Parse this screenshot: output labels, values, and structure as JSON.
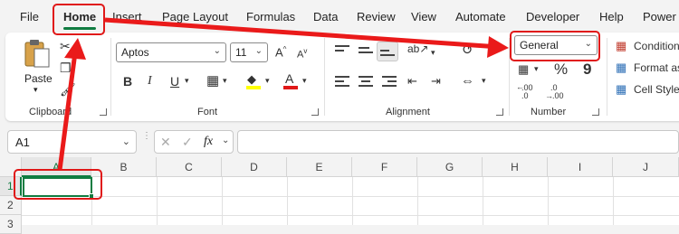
{
  "tabs": [
    "File",
    "Home",
    "Insert",
    "Page Layout",
    "Formulas",
    "Data",
    "Review",
    "View",
    "Automate",
    "Developer",
    "Help",
    "Power"
  ],
  "clipboard": {
    "paste_label": "Paste",
    "group_label": "Clipboard"
  },
  "font": {
    "font_name": "Aptos",
    "font_size": "11",
    "bold": "B",
    "italic": "I",
    "underline": "U",
    "grow": "A",
    "shrink": "A",
    "group_label": "Font"
  },
  "alignment": {
    "group_label": "Alignment"
  },
  "number": {
    "format": "General",
    "percent": "%",
    "comma": "9",
    "increase_decimal": ".00",
    "decrease_decimal": ".0",
    "group_label": "Number"
  },
  "styles": {
    "conditional": "Condition",
    "format_as": "Format as",
    "cell_styles": "Cell Styles"
  },
  "formula_bar": {
    "name_box": "A1",
    "fx": "fx"
  },
  "grid": {
    "columns": [
      "A",
      "B",
      "C",
      "D",
      "E",
      "F",
      "G",
      "H",
      "I",
      "J"
    ],
    "rows": [
      "1",
      "2",
      "3"
    ]
  },
  "colors": {
    "accent": "#107c41",
    "callout": "#e01818",
    "highlight_yellow": "#ffff00",
    "font_red": "#e01818"
  }
}
